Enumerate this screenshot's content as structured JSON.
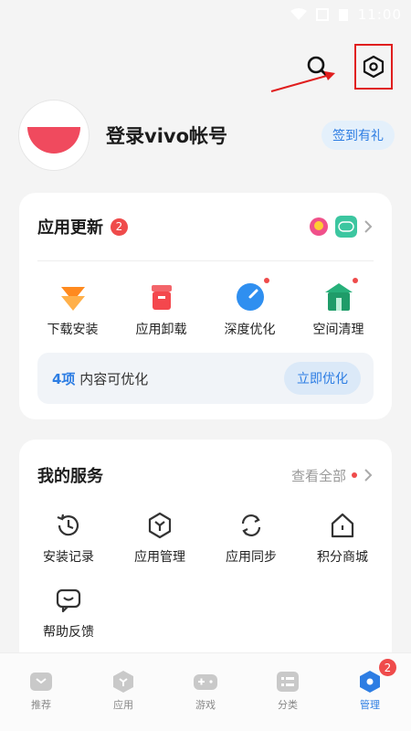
{
  "status_bar": {
    "time": "11:00"
  },
  "profile": {
    "login_text": "登录vivo帐号",
    "signin_label": "签到有礼"
  },
  "app_update": {
    "title": "应用更新",
    "badge": "2",
    "tools": [
      {
        "label": "下载安装",
        "icon": "download-icon",
        "dot": false
      },
      {
        "label": "应用卸载",
        "icon": "trash-icon",
        "dot": false
      },
      {
        "label": "深度优化",
        "icon": "gauge-icon",
        "dot": true
      },
      {
        "label": "空间清理",
        "icon": "broom-icon",
        "dot": true
      }
    ],
    "optimize": {
      "count": "4项",
      "text": " 内容可优化",
      "button": "立即优化"
    }
  },
  "services": {
    "title": "我的服务",
    "view_all": "查看全部",
    "items": [
      {
        "label": "安装记录",
        "icon": "history-icon"
      },
      {
        "label": "应用管理",
        "icon": "hexagon-y-icon"
      },
      {
        "label": "应用同步",
        "icon": "sync-icon"
      },
      {
        "label": "积分商城",
        "icon": "store-icon"
      },
      {
        "label": "帮助反馈",
        "icon": "feedback-icon"
      }
    ]
  },
  "tabs": [
    {
      "label": "推荐",
      "icon": "recommend-icon"
    },
    {
      "label": "应用",
      "icon": "apps-icon"
    },
    {
      "label": "游戏",
      "icon": "gamepad-icon"
    },
    {
      "label": "分类",
      "icon": "category-icon"
    },
    {
      "label": "管理",
      "icon": "manage-icon",
      "badge": "2",
      "active": true
    }
  ],
  "colors": {
    "accent": "#2d7de3",
    "badge_red": "#ef4b4b",
    "highlight_box": "#e01e1e"
  }
}
